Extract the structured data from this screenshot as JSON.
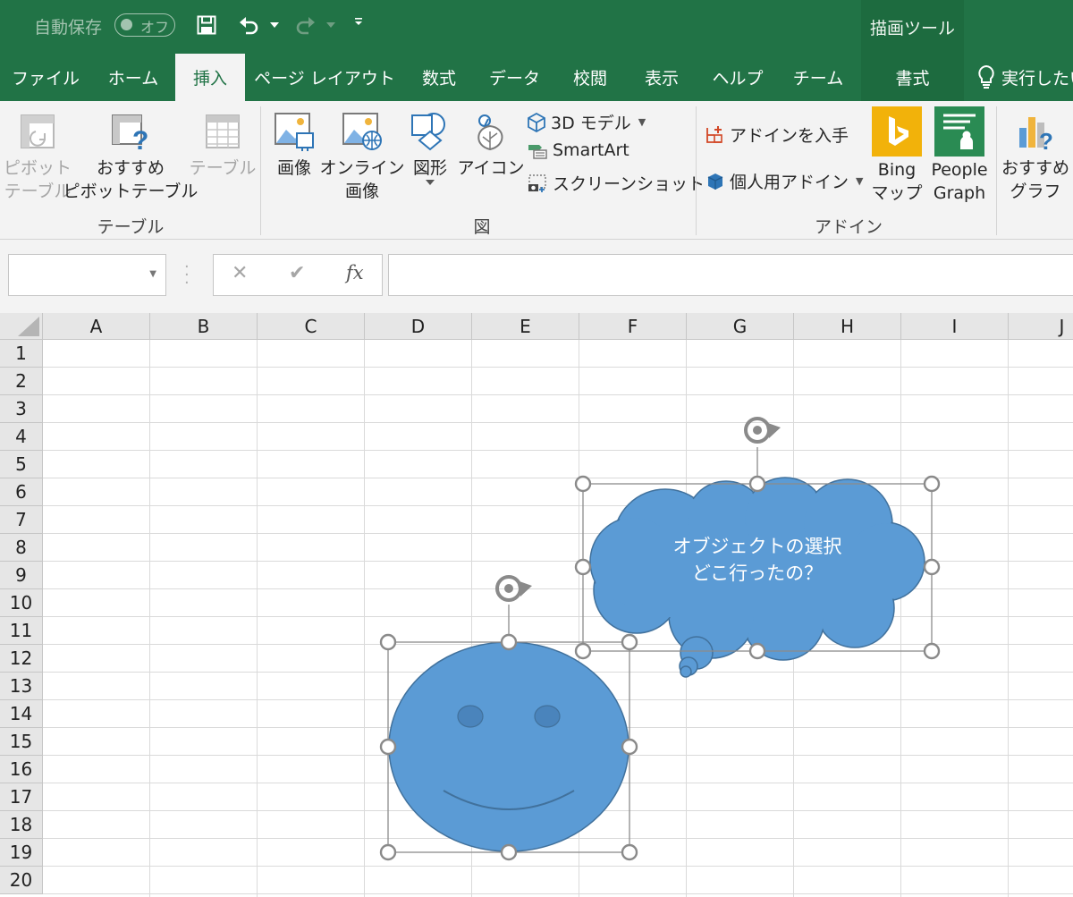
{
  "title_bar": {
    "autosave_label": "自動保存",
    "autosave_state": "オフ",
    "drawing_tools_title": "描画ツール"
  },
  "tabs": [
    {
      "label": "ファイル"
    },
    {
      "label": "ホーム"
    },
    {
      "label": "挿入",
      "active": true
    },
    {
      "label": "ページ レイアウト"
    },
    {
      "label": "数式"
    },
    {
      "label": "データ"
    },
    {
      "label": "校閲"
    },
    {
      "label": "表示"
    },
    {
      "label": "ヘルプ"
    },
    {
      "label": "チーム"
    },
    {
      "label": "書式"
    }
  ],
  "tell_me": "実行したい",
  "ribbon": {
    "table_group": {
      "label": "テーブル",
      "pivot_line1": "ピボット",
      "pivot_line2": "テーブル",
      "recommended_pivot_line1": "おすすめ",
      "recommended_pivot_line2": "ピボットテーブル",
      "table": "テーブル"
    },
    "illustrations_group": {
      "label": "図",
      "picture": "画像",
      "online_picture_line1": "オンライン",
      "online_picture_line2": "画像",
      "shapes": "図形",
      "icons": "アイコン",
      "model_3d": "3D モデル",
      "smartart": "SmartArt",
      "screenshot": "スクリーンショット"
    },
    "addins_group": {
      "label": "アドイン",
      "get_addins": "アドインを入手",
      "my_addins": "個人用アドイン",
      "bing_line1": "Bing",
      "bing_line2": "マップ",
      "people_line1": "People",
      "people_line2": "Graph"
    },
    "charts_group": {
      "recommended_line1": "おすすめ",
      "recommended_line2": "グラフ"
    }
  },
  "formula_bar": {
    "name_box_value": "",
    "formula_value": "",
    "cancel_symbol": "✕",
    "enter_symbol": "✔",
    "fx_symbol": "fx"
  },
  "sheet": {
    "columns": [
      "A",
      "B",
      "C",
      "D",
      "E",
      "F",
      "G",
      "H",
      "I",
      "J"
    ],
    "rows": [
      "1",
      "2",
      "3",
      "4",
      "5",
      "6",
      "7",
      "8",
      "9",
      "10",
      "11",
      "12",
      "13",
      "14",
      "15",
      "16",
      "17",
      "18",
      "19",
      "20"
    ]
  },
  "callout": {
    "line1": "オブジェクトの選択",
    "line2": "どこ行ったの？"
  },
  "colors": {
    "excel_green": "#217346",
    "shape_fill": "#5b9bd5",
    "shape_outline": "#41719c"
  }
}
